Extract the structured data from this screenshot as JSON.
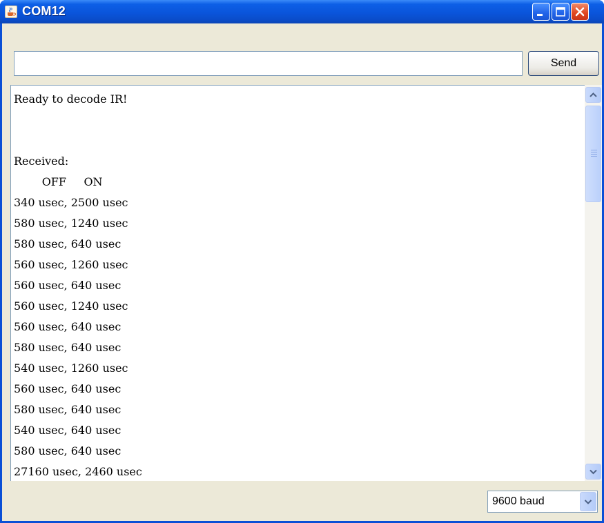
{
  "window": {
    "title": "COM12",
    "icon": "java-coffee-cup-icon",
    "controls": [
      "minimize-icon",
      "maximize-icon",
      "close-icon"
    ]
  },
  "send_bar": {
    "input_value": "",
    "send_label": "Send"
  },
  "output": {
    "lines": [
      "Ready to decode IR!",
      "",
      "",
      "Received:",
      "        OFF     ON",
      "340 usec, 2500 usec",
      "580 usec, 1240 usec",
      "580 usec, 640 usec",
      "560 usec, 1260 usec",
      "560 usec, 640 usec",
      "560 usec, 1240 usec",
      "560 usec, 640 usec",
      "580 usec, 640 usec",
      "540 usec, 1260 usec",
      "560 usec, 640 usec",
      "580 usec, 640 usec",
      "540 usec, 640 usec",
      "580 usec, 640 usec",
      "27160 usec, 2460 usec"
    ]
  },
  "status_bar": {
    "baud_selected": "9600 baud"
  },
  "colors": {
    "titlebar": "#0a55db",
    "client_background": "#ece9d8",
    "close_button": "#e0451f"
  }
}
